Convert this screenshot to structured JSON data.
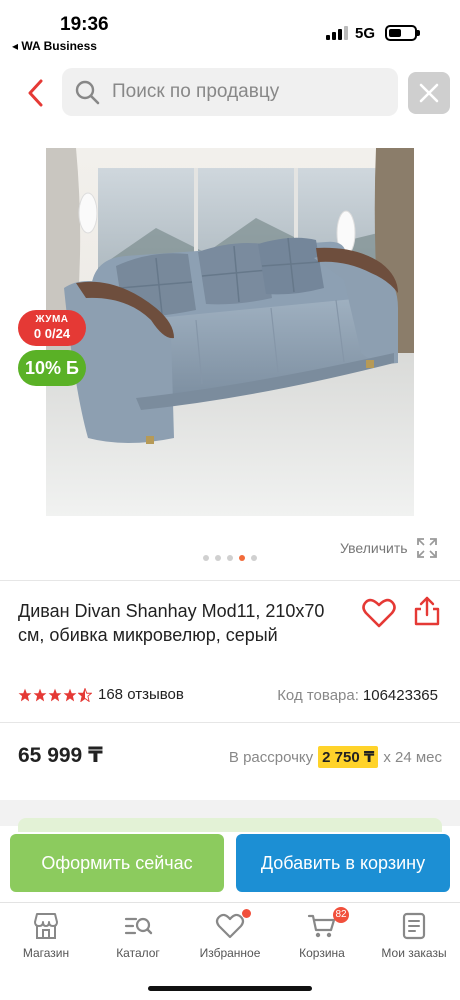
{
  "status_bar": {
    "time": "19:36",
    "back_app": "◂ WA Business",
    "network": "5G"
  },
  "search": {
    "placeholder": "Поиск по продавцу"
  },
  "product": {
    "image_icon": "sofa-photo",
    "promo_juma_title": "ЖУМА",
    "promo_juma_value": "0 0/24",
    "discount_label": "10% Б",
    "gallery_dots": 5,
    "active_dot": 4,
    "zoom_label": "Увеличить",
    "title": "Диван Divan Shanhay Mod11, 210x70 см, обивка микровелюр, серый",
    "rating": 4.5,
    "reviews": "168 отзывов",
    "code_label": "Код товара:",
    "code_value": "106423365",
    "price": "65 999 ₸",
    "installment_prefix": "В рассрочку",
    "installment_amount": "2 750 ₸",
    "installment_suffix": "х 24 мес"
  },
  "actions": {
    "checkout_label": "Оформить сейчас",
    "cart_label": "Добавить в корзину"
  },
  "nav": {
    "items": [
      {
        "label": "Магазин",
        "icon": "shop-icon"
      },
      {
        "label": "Каталог",
        "icon": "catalog-icon"
      },
      {
        "label": "Избранное",
        "icon": "heart-icon",
        "has_dot": true
      },
      {
        "label": "Корзина",
        "icon": "cart-icon",
        "badge": "82"
      },
      {
        "label": "Мои заказы",
        "icon": "orders-icon"
      }
    ]
  },
  "colors": {
    "accent_red": "#e53935",
    "green_discount": "#5ab126",
    "checkout_green": "#8ccb5e",
    "cart_blue": "#1c8fd4",
    "installment_yellow": "#ffd32a"
  }
}
